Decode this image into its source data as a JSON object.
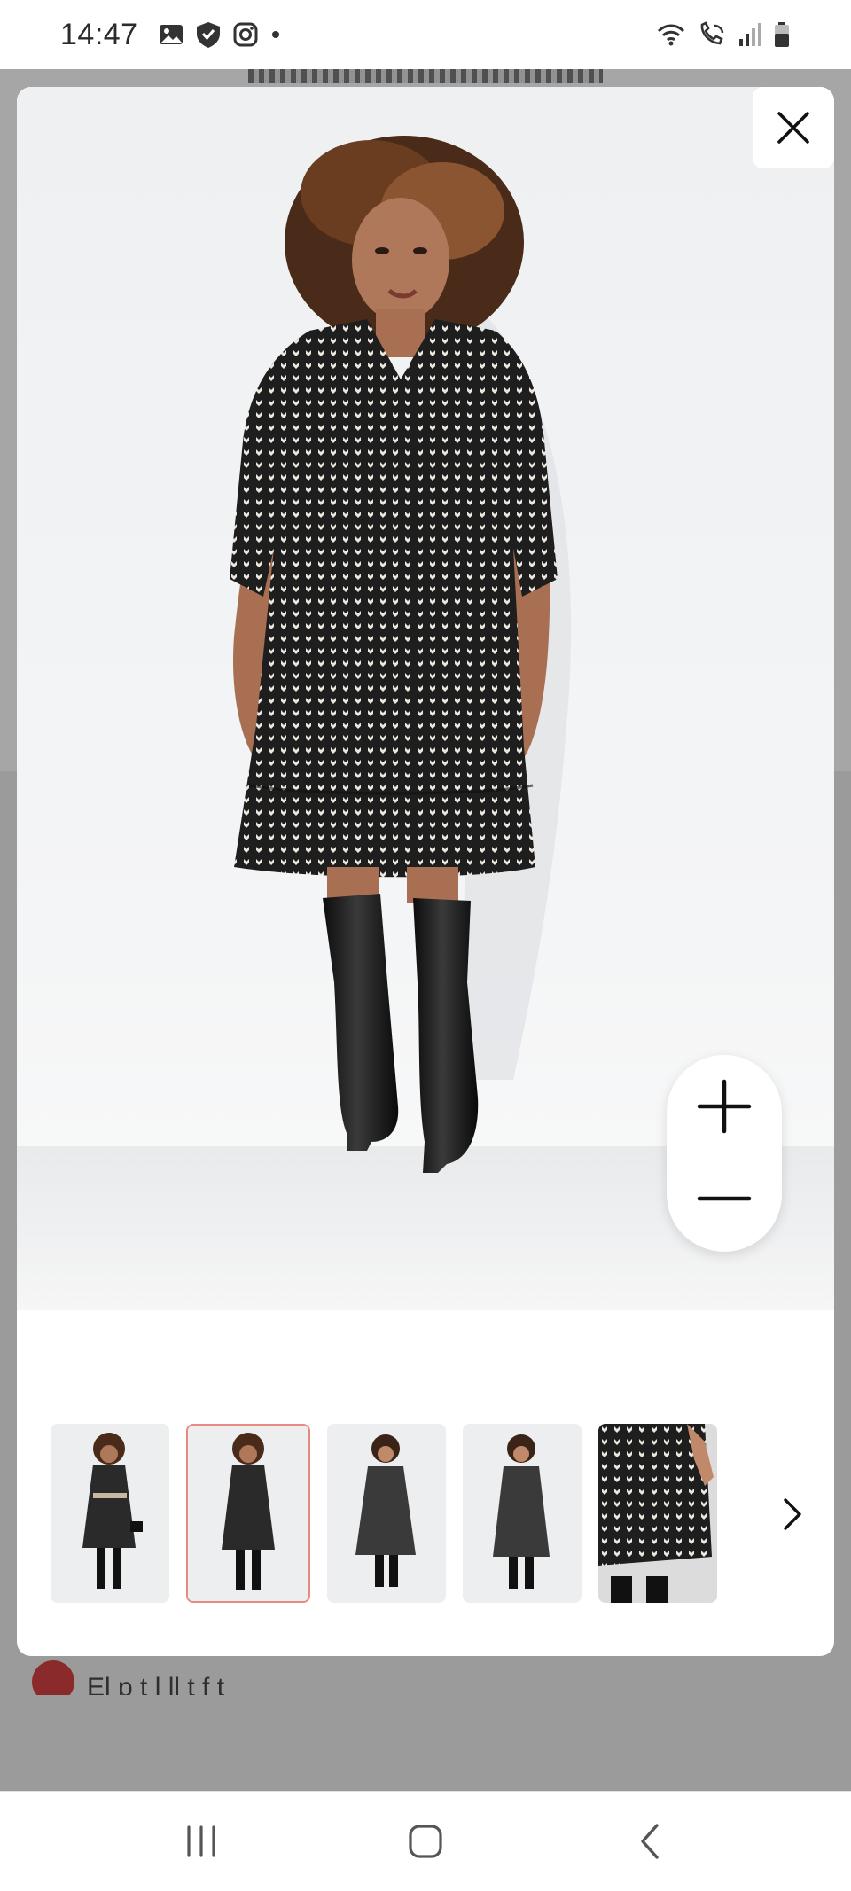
{
  "status_bar": {
    "time": "14:47",
    "icons": [
      "gallery-icon",
      "shield-icon",
      "instagram-icon",
      "dot-icon",
      "wifi-icon",
      "wifi-call-icon",
      "signal-icon",
      "battery-icon"
    ]
  },
  "backdrop": {
    "partial_text": "El p   t     l      ll    t  f   t"
  },
  "modal": {
    "close_label": "Close",
    "zoom": {
      "zoom_in_icon": "plus-icon",
      "zoom_out_icon": "minus-icon"
    },
    "thumbnails": [
      {
        "view": "front-belted-with-bag",
        "selected": false
      },
      {
        "view": "front-standing",
        "selected": true
      },
      {
        "view": "model-front-hands-on-hips",
        "selected": false
      },
      {
        "view": "model-front-relaxed",
        "selected": false
      },
      {
        "view": "detail-hem-closeup",
        "selected": false
      }
    ],
    "next_icon": "chevron-right-icon"
  },
  "colors": {
    "selected_thumb_border": "#e88a80",
    "dress_pattern": "#1e1e1e",
    "backdrop": "#a6a6a6"
  },
  "nav_bar": {
    "icons": [
      "recent-apps-icon",
      "home-icon",
      "back-icon"
    ]
  }
}
